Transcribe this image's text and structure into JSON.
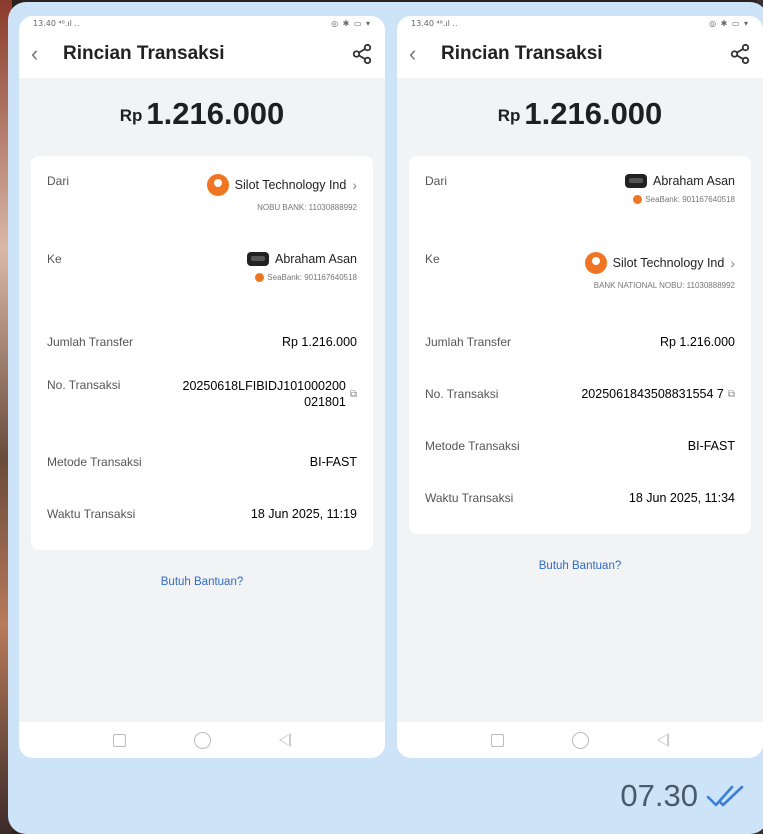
{
  "message": {
    "time": "07.30",
    "status_icon": "double-check-icon"
  },
  "screenshots": [
    {
      "status_bar": {
        "time": "13.40",
        "signal": "⁴⁶.ıl ..",
        "icons": "◎ ✱ ▭ ▾"
      },
      "header": {
        "title": "Rincian Transaksi"
      },
      "amount": {
        "currency": "Rp",
        "value": "1.216.000"
      },
      "from": {
        "label": "Dari",
        "name": "Silot Technology Ind",
        "sub": "NOBU BANK: 11030888992"
      },
      "to": {
        "label": "Ke",
        "name": "Abraham Asan",
        "sub": "SeaBank: 901167640518"
      },
      "details": {
        "amount_label": "Jumlah Transfer",
        "amount_value": "Rp 1.216.000",
        "txn_label": "No. Transaksi",
        "txn_value_1": "20250618LFIBIDJ101000200",
        "txn_value_2": "021801",
        "method_label": "Metode Transaksi",
        "method_value": "BI-FAST",
        "time_label": "Waktu Transaksi",
        "time_value": "18 Jun 2025, 11:19"
      },
      "help": "Butuh Bantuan?"
    },
    {
      "status_bar": {
        "time": "13.40",
        "signal": "⁴⁶.ıl ..",
        "icons": "◎ ✱ ▭ ▾"
      },
      "header": {
        "title": "Rincian Transaksi"
      },
      "amount": {
        "currency": "Rp",
        "value": "1.216.000"
      },
      "from": {
        "label": "Dari",
        "name": "Abraham Asan",
        "sub": "SeaBank: 901167640518"
      },
      "to": {
        "label": "Ke",
        "name": "Silot Technology Ind",
        "sub": "BANK NATIONAL NOBU: 11030888992"
      },
      "details": {
        "amount_label": "Jumlah Transfer",
        "amount_value": "Rp 1.216.000",
        "txn_label": "No. Transaksi",
        "txn_value": "2025061843508831554 7",
        "method_label": "Metode Transaksi",
        "method_value": "BI-FAST",
        "time_label": "Waktu Transaksi",
        "time_value": "18 Jun 2025, 11:34"
      },
      "help": "Butuh Bantuan?"
    }
  ]
}
